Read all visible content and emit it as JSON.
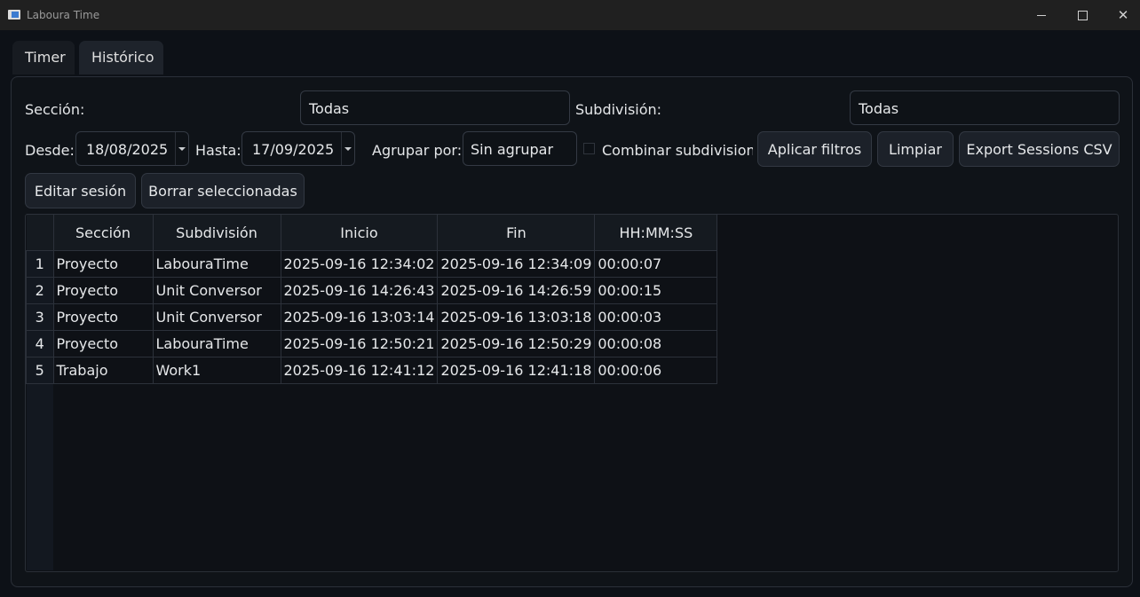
{
  "window": {
    "title": "Laboura Time",
    "controls": [
      "minimize",
      "maximize",
      "close"
    ]
  },
  "tabs": [
    {
      "label": "Timer",
      "active": false
    },
    {
      "label": "Histórico",
      "active": true
    }
  ],
  "filters": {
    "section_label": "Sección:",
    "section_value": "Todas",
    "subdivision_label": "Subdivisión:",
    "subdivision_value": "Todas",
    "from_label": "Desde:",
    "from_value": "18/08/2025",
    "to_label": "Hasta:",
    "to_value": "17/09/2025",
    "group_label": "Agrupar por:",
    "group_value": "Sin agrupar",
    "combine_label": "Combinar subdivisione",
    "combine_checked": false
  },
  "buttons": {
    "apply": "Aplicar filtros",
    "clear": "Limpiar",
    "export": "Export Sessions CSV",
    "edit": "Editar sesión",
    "delete": "Borrar seleccionadas"
  },
  "table": {
    "headers": [
      "Sección",
      "Subdivisión",
      "Inicio",
      "Fin",
      "HH:MM:SS"
    ],
    "rows": [
      {
        "n": "1",
        "seccion": "Proyecto",
        "subdivision": "LabouraTime",
        "inicio": "2025-09-16 12:34:02",
        "fin": "2025-09-16 12:34:09",
        "duracion": "00:00:07"
      },
      {
        "n": "2",
        "seccion": "Proyecto",
        "subdivision": "Unit Conversor",
        "inicio": "2025-09-16 14:26:43",
        "fin": "2025-09-16 14:26:59",
        "duracion": "00:00:15"
      },
      {
        "n": "3",
        "seccion": "Proyecto",
        "subdivision": "Unit Conversor",
        "inicio": "2025-09-16 13:03:14",
        "fin": "2025-09-16 13:03:18",
        "duracion": "00:00:03"
      },
      {
        "n": "4",
        "seccion": "Proyecto",
        "subdivision": "LabouraTime",
        "inicio": "2025-09-16 12:50:21",
        "fin": "2025-09-16 12:50:29",
        "duracion": "00:00:08"
      },
      {
        "n": "5",
        "seccion": "Trabajo",
        "subdivision": "Work1",
        "inicio": "2025-09-16 12:41:12",
        "fin": "2025-09-16 12:41:18",
        "duracion": "00:00:06"
      }
    ]
  },
  "colors": {
    "background": "#0d1117",
    "titlebar": "#202020",
    "button": "#1c2129",
    "border": "#343a44"
  }
}
